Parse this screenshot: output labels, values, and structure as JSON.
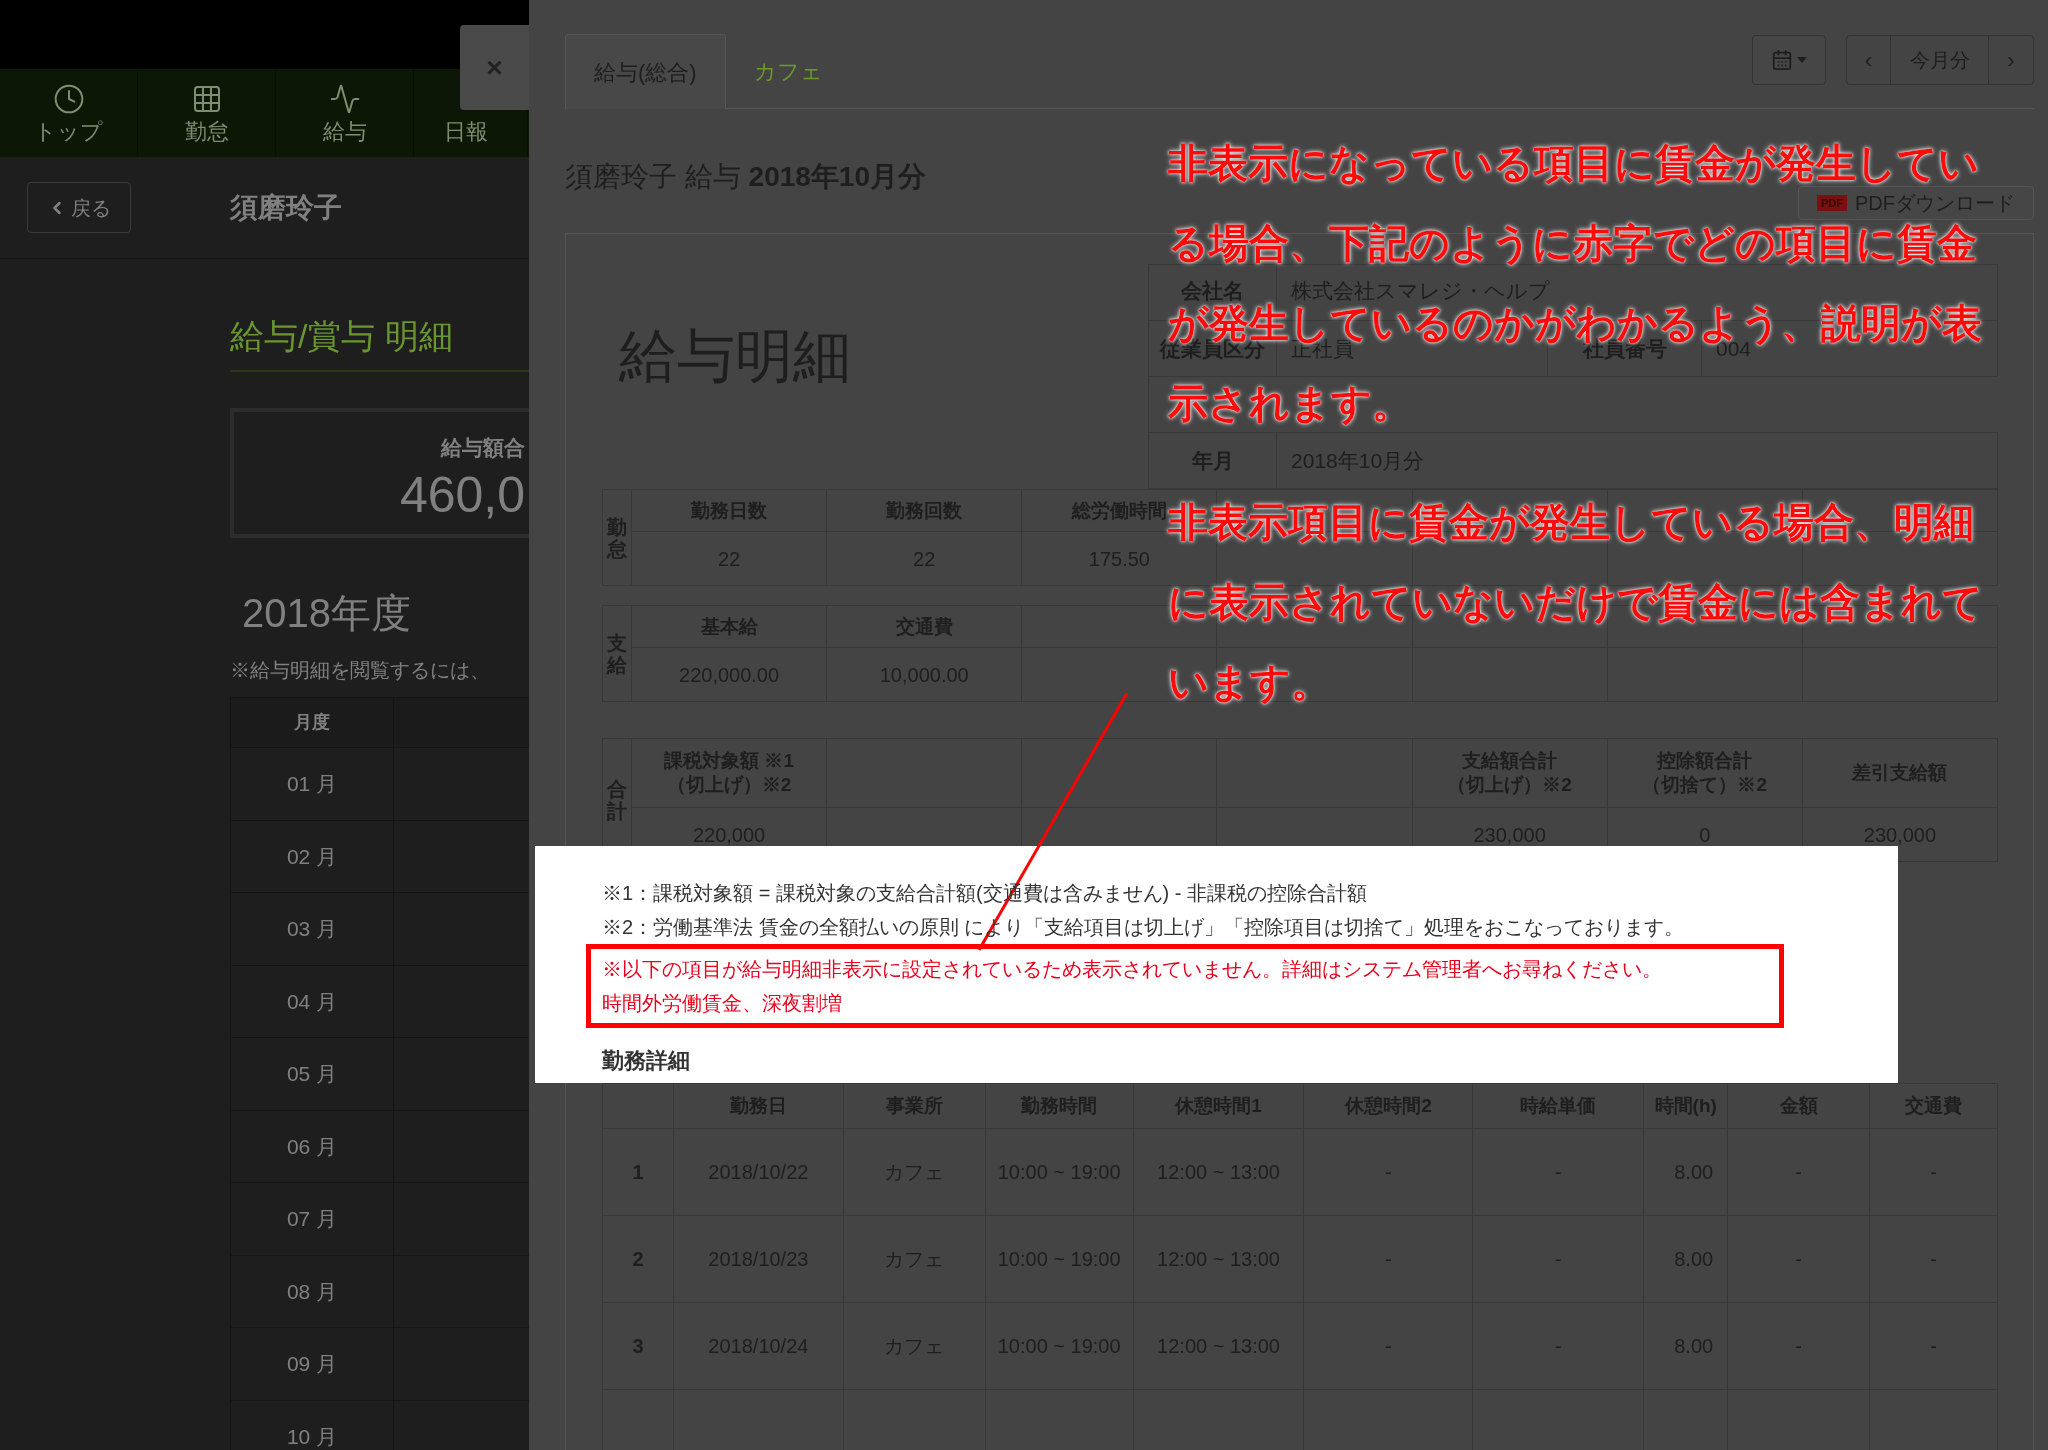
{
  "top_nav": {
    "items": [
      {
        "label": "トップ"
      },
      {
        "label": "勤怠"
      },
      {
        "label": "給与"
      },
      {
        "label": "日報"
      }
    ]
  },
  "header": {
    "back_button": "戻る",
    "employee_name": "須磨玲子"
  },
  "payroll_list": {
    "title": "給与/賞与 明細",
    "total_label": "給与額合",
    "total_value": "460,0",
    "year": "2018年度",
    "note": "※給与明細を閲覧するには、",
    "table": {
      "columns": [
        "月度"
      ],
      "rows": [
        "01 月",
        "02 月",
        "03 月",
        "04 月",
        "05 月",
        "06 月",
        "07 月",
        "08 月",
        "09 月",
        "10 月"
      ]
    }
  },
  "drawer": {
    "close": "×",
    "tabs": [
      {
        "label": "給与(総合)",
        "selected": true
      },
      {
        "label": "カフェ",
        "selected": false
      }
    ],
    "period_nav": {
      "prev": "‹",
      "current": "今月分",
      "next": "›"
    },
    "title": "須磨玲子 給与 **2018年10月分**",
    "pdf_button": {
      "badge": "PDF",
      "label": "PDFダウンロード"
    },
    "payslip": {
      "heading": "給与明細",
      "info_rows": [
        {
          "kind": "row",
          "cells": [
            "会社名",
            "株式会社スマレジ・ヘルプ"
          ]
        },
        {
          "kind": "row",
          "cells": [
            "従業員区分",
            "正社員",
            "社員番号",
            "004"
          ]
        },
        {
          "kind": "obscured"
        },
        {
          "kind": "row",
          "cells": [
            "年月",
            "2018年10月分"
          ]
        }
      ],
      "sections": [
        {
          "label": "勤怠",
          "columns": [
            {
              "kind": "item",
              "header": [
                "勤務日数"
              ],
              "value": "22"
            },
            {
              "kind": "item",
              "header": [
                "勤務回数"
              ],
              "value": "22"
            },
            {
              "kind": "item",
              "header": [
                "総労働時間"
              ],
              "value": "175.50"
            },
            {
              "kind": "blank"
            },
            {
              "kind": "blank"
            },
            {
              "kind": "blank"
            },
            {
              "kind": "blank"
            }
          ]
        },
        {
          "label": "支給",
          "columns": [
            {
              "kind": "item",
              "header": [
                "基本給"
              ],
              "value": "220,000.00"
            },
            {
              "kind": "item",
              "header": [
                "交通費"
              ],
              "value": "10,000.00"
            },
            {
              "kind": "blank"
            },
            {
              "kind": "blank"
            },
            {
              "kind": "blank"
            },
            {
              "kind": "blank"
            },
            {
              "kind": "blank"
            }
          ]
        },
        {
          "label": "合計",
          "columns": [
            {
              "kind": "item",
              "header": [
                "課税対象額 ※1",
                "（切上げ）※2"
              ],
              "value": "220,000"
            },
            {
              "kind": "blank"
            },
            {
              "kind": "blank"
            },
            {
              "kind": "blank"
            },
            {
              "kind": "item",
              "header": [
                "支給額合計",
                "（切上げ）※2"
              ],
              "value": "230,000"
            },
            {
              "kind": "item",
              "header": [
                "控除額合計",
                "（切捨て）※2"
              ],
              "value": "0"
            },
            {
              "kind": "item",
              "header": [
                "差引支給額"
              ],
              "value": "230,000"
            }
          ]
        }
      ],
      "notes": [
        "※1：課税対象額 = 課税対象の支給合計額(交通費は含みません) - 非課税の控除合計額",
        "※2：労働基準法 賃金の全額払いの原則 により「支給項目は切上げ」「控除項目は切捨て」処理をおこなっております。"
      ],
      "warning": [
        "※以下の項目が給与明細非表示に設定されているため表示されていません。詳細はシステム管理者へお尋ねください。",
        "時間外労働賃金、深夜割増"
      ],
      "detail": {
        "title": "勤務詳細",
        "columns": [
          "",
          "勤務日",
          "事業所",
          "勤務時間",
          "休憩時間1",
          "休憩時間2",
          "時給単価",
          "時間(h)",
          "金額",
          "交通費"
        ],
        "rows": [
          [
            "1",
            "2018/10/22",
            "カフェ",
            "10:00 ~ 19:00",
            "12:00 ~ 13:00",
            "-",
            "-",
            "8.00",
            "-",
            "-"
          ],
          [
            "2",
            "2018/10/23",
            "カフェ",
            "10:00 ~ 19:00",
            "12:00 ~ 13:00",
            "-",
            "-",
            "8.00",
            "-",
            "-"
          ],
          [
            "3",
            "2018/10/24",
            "カフェ",
            "10:00 ~ 19:00",
            "12:00 ~ 13:00",
            "-",
            "-",
            "8.00",
            "-",
            "-"
          ]
        ]
      }
    }
  },
  "callouts": [
    {
      "lines": [
        "非表示になっている項目に賃金が発生してい",
        "る場合、下記のように赤字でどの項目に賃金",
        "が発生しているのかがわかるよう、説明が表",
        "示されます。"
      ]
    },
    {
      "lines": [
        "非表示項目に賃金が発生している場合、明細",
        "に表示されていないだけで賃金には含まれて",
        "います。"
      ]
    }
  ]
}
